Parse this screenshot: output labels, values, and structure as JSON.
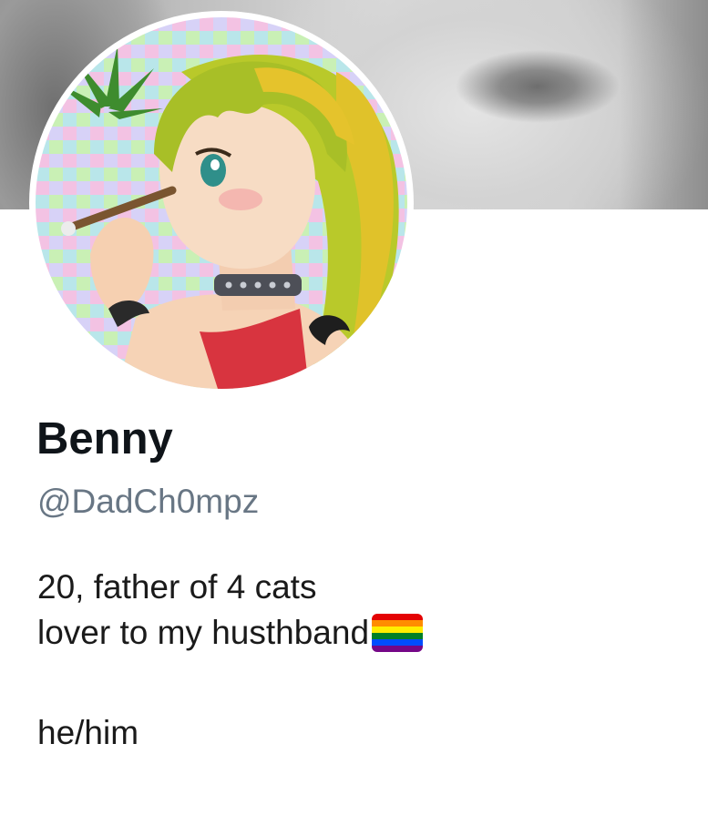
{
  "profile": {
    "display_name": "Benny",
    "handle": "@DadCh0mpz",
    "bio": {
      "line1": "20, father of 4 cats",
      "line2": "lover to my husthband",
      "line2_emoji": "pride-flag-icon",
      "line3": "he/him"
    }
  },
  "colors": {
    "name": "#0f1419",
    "handle": "#687684",
    "bio_text": "#1a1a1a",
    "pride_flag": [
      "#e40303",
      "#ff8c00",
      "#ffed00",
      "#008026",
      "#004dff",
      "#750787"
    ]
  }
}
